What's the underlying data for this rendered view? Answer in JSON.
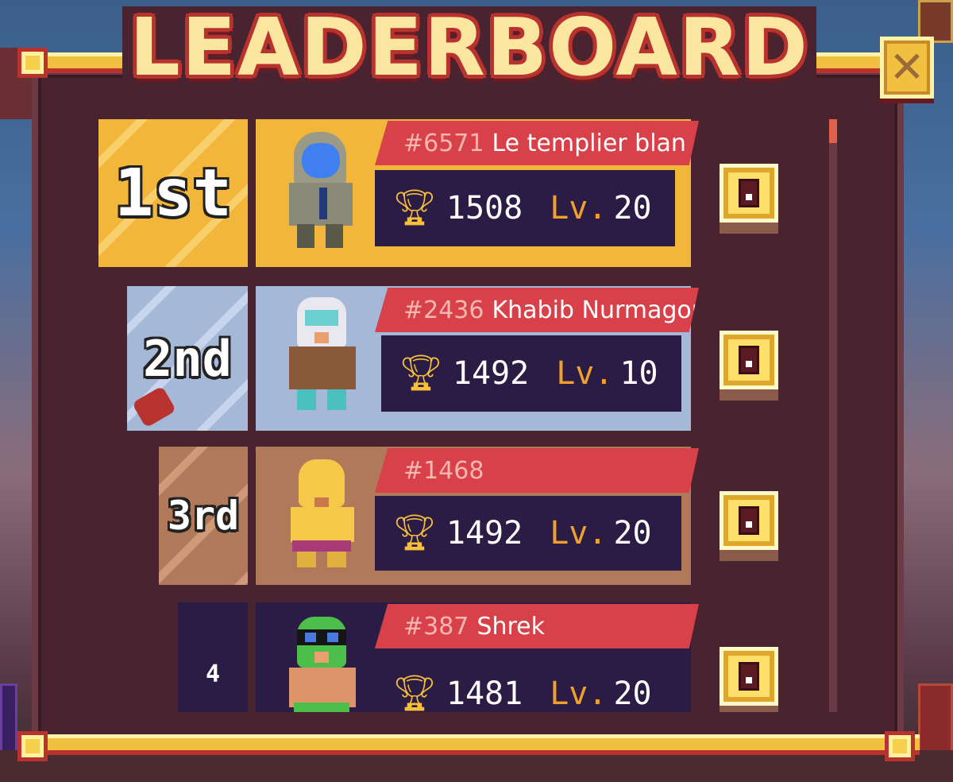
{
  "title": "LEADERBOARD",
  "close_icon": "close-x-icon",
  "colors": {
    "gold": "#f2b63b",
    "silver": "#a6b8d8",
    "bronze": "#b07a5a",
    "banner_red": "#d9414a",
    "stats_bg": "#2b1c45",
    "level_orange": "#f1a02b",
    "panel_bg": "#4a2330"
  },
  "entries": [
    {
      "rank": "1st",
      "id": "#6571",
      "name": "Le templier blan",
      "trophies": "1508",
      "level_label": "Lv.",
      "level": "20",
      "avatar_icon": "astronaut-avatar-icon"
    },
    {
      "rank": "2nd",
      "id": "#2436",
      "name": "Khabib Nurmagor",
      "trophies": "1492",
      "level_label": "Lv.",
      "level": "10",
      "avatar_icon": "luchador-avatar-icon"
    },
    {
      "rank": "3rd",
      "id": "#1468",
      "name": "",
      "trophies": "1492",
      "level_label": "Lv.",
      "level": "20",
      "avatar_icon": "yellow-wrestler-avatar-icon"
    },
    {
      "rank": "4",
      "id": "#387",
      "name": "Shrek",
      "trophies": "1481",
      "level_label": "Lv.",
      "level": "20",
      "avatar_icon": "green-masked-avatar-icon"
    }
  ]
}
